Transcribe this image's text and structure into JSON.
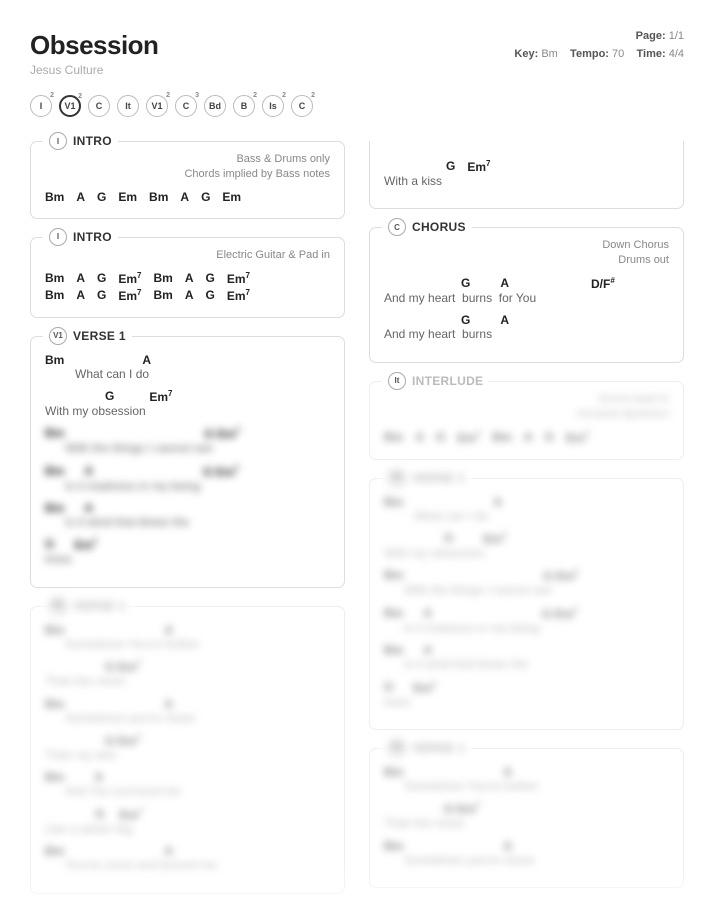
{
  "header": {
    "title": "Obsession",
    "artist": "Jesus Culture",
    "page_label": "Page:",
    "page_value": "1/1",
    "key_label": "Key:",
    "key_value": "Bm",
    "tempo_label": "Tempo:",
    "tempo_value": "70",
    "time_label": "Time:",
    "time_value": "4/4"
  },
  "nav": [
    {
      "label": "I",
      "sup": "2",
      "active": false
    },
    {
      "label": "V1",
      "sup": "2",
      "active": true
    },
    {
      "label": "C",
      "sup": "",
      "active": false
    },
    {
      "label": "It",
      "sup": "",
      "active": false
    },
    {
      "label": "V1",
      "sup": "2",
      "active": false
    },
    {
      "label": "C",
      "sup": "3",
      "active": false
    },
    {
      "label": "Bd",
      "sup": "",
      "active": false
    },
    {
      "label": "B",
      "sup": "2",
      "active": false
    },
    {
      "label": "Is",
      "sup": "2",
      "active": false
    },
    {
      "label": "C",
      "sup": "2",
      "active": false
    }
  ],
  "sections": {
    "intro1": {
      "badge": "I",
      "name": "INTRO",
      "note1": "Bass & Drums only",
      "note2": "Chords implied by Bass notes",
      "rows": [
        [
          "Bm",
          "A",
          "G",
          "Em",
          "Bm",
          "A",
          "G",
          "Em"
        ]
      ]
    },
    "intro2": {
      "badge": "I",
      "name": "INTRO",
      "note1": "Electric Guitar & Pad in",
      "rows": [
        [
          "Bm",
          "A",
          "G",
          "Em7",
          "Bm",
          "A",
          "G",
          "Em7"
        ],
        [
          "Bm",
          "A",
          "G",
          "Em7",
          "Bm",
          "A",
          "G",
          "Em7"
        ]
      ]
    },
    "verse1a": {
      "badge": "V1",
      "name": "VERSE 1",
      "lines": [
        {
          "chords": [
            [
              "Bm",
              0
            ],
            [
              "A",
              90
            ]
          ],
          "lyric": "What can I do",
          "indent": 30
        },
        {
          "chords": [
            [
              "G",
              60
            ],
            [
              "Em7",
              100
            ]
          ],
          "lyric": "With my obsession",
          "indent": 0
        }
      ]
    },
    "withakiss": {
      "chord1": "G",
      "chord2": "Em7",
      "lyric": "With a kiss"
    },
    "chorus": {
      "badge": "C",
      "name": "CHORUS",
      "note1": "Down Chorus",
      "note2": "Drums out",
      "lines": [
        {
          "chords": [
            [
              "G",
              75
            ],
            [
              "A",
              120
            ],
            [
              "D/F#",
              215
            ]
          ],
          "segments": [
            "And my heart",
            "burns",
            "for You"
          ]
        },
        {
          "chords": [
            [
              "G",
              75
            ],
            [
              "A",
              120
            ]
          ],
          "segments": [
            "And my heart",
            "burns"
          ]
        }
      ]
    },
    "interlude": {
      "badge": "It",
      "name": "INTERLUDE",
      "note1": "Drums back in",
      "note2": "Increase dynamics",
      "rows": [
        [
          "Bm",
          "A",
          "G",
          "Em7",
          "Bm",
          "A",
          "G",
          "Em7"
        ]
      ]
    }
  }
}
